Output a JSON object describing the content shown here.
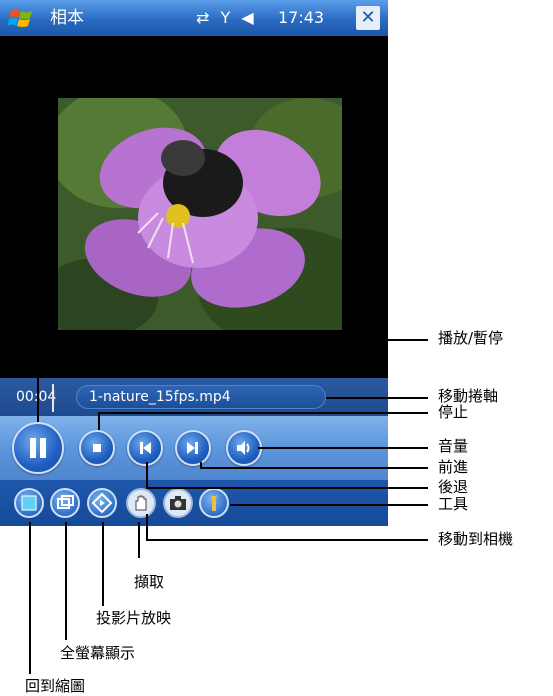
{
  "title_bar": {
    "app_title": "相本",
    "clock": "17:43",
    "close_label": "✕",
    "status_icons": [
      "connectivity-icon",
      "signal-off-icon",
      "speaker-icon"
    ]
  },
  "seek_bar": {
    "time": "00:04",
    "file_name": "1-nature_15fps.mp4"
  },
  "controls": {
    "play_pause_glyph": "❚❚",
    "stop_glyph": "■",
    "prev_glyph": "⏮",
    "next_glyph": "⏭",
    "volume_glyph": "🔊"
  },
  "callouts": {
    "play_pause": "播放/暫停",
    "scroll": "移動捲軸",
    "stop": "停止",
    "volume": "音量",
    "next": "前進",
    "prev": "後退",
    "tools": "工具",
    "camera": "移動到相機",
    "capture": "擷取",
    "slideshow": "投影片放映",
    "fullscreen": "全螢幕顯示",
    "thumbnails": "回到縮圖"
  },
  "colors": {
    "title_bar": "#2a6bc2",
    "control_bar": "#5c96dc",
    "toolbar": "#1e57ab",
    "video_bg": "#000000"
  }
}
